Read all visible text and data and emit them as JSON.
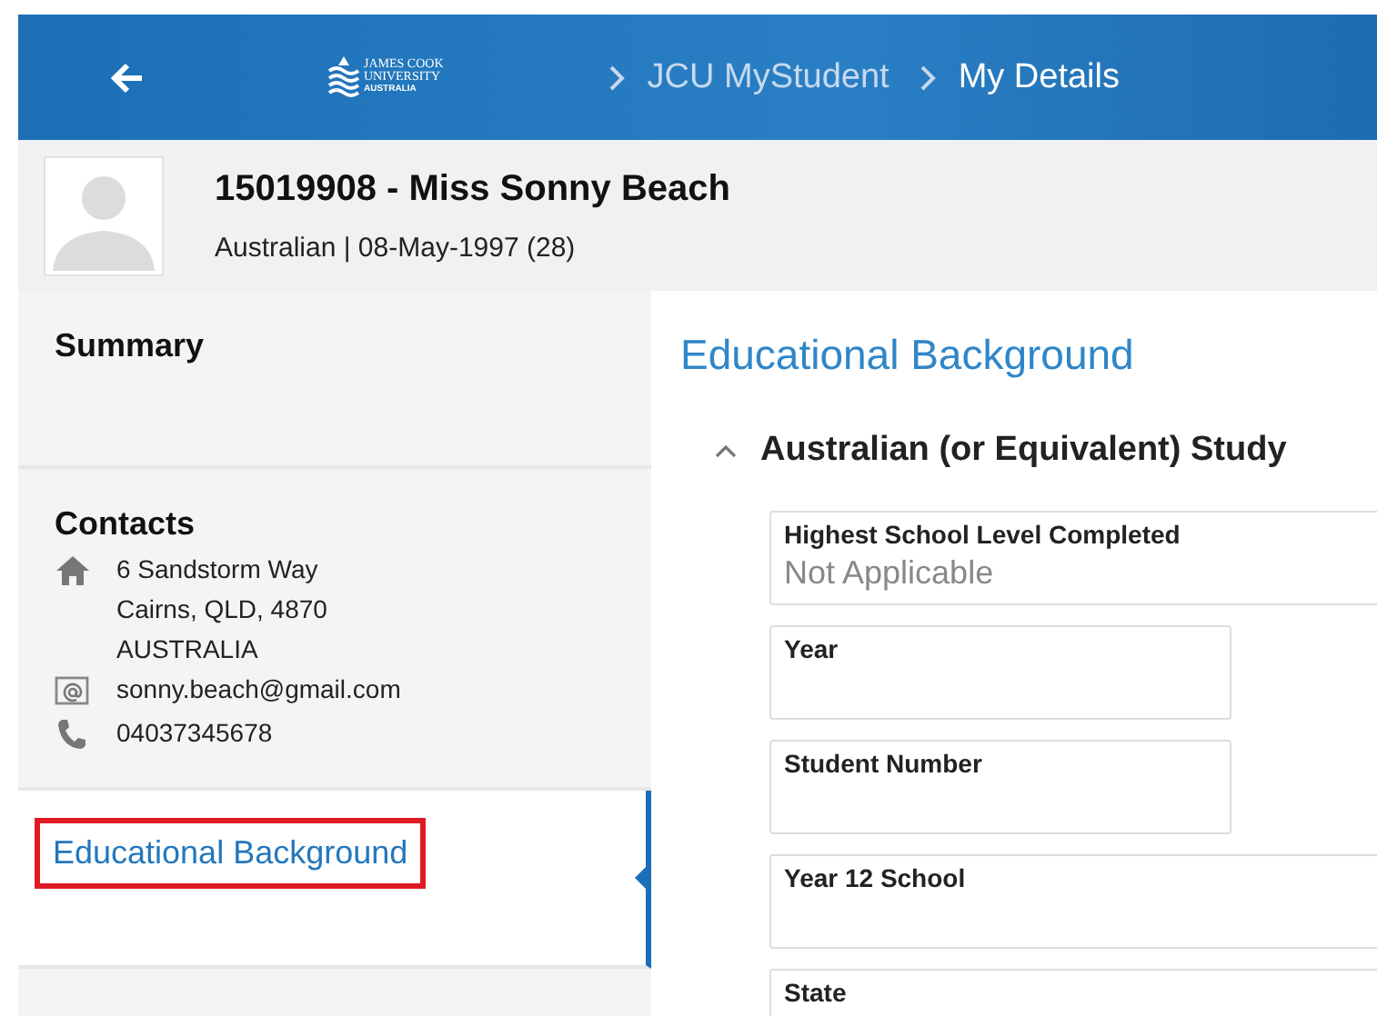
{
  "header": {
    "logo": {
      "lines": [
        "JAMES COOK",
        "UNIVERSITY",
        "AUSTRALIA"
      ]
    },
    "breadcrumbs": [
      {
        "label": "JCU MyStudent",
        "selected": false
      },
      {
        "label": "My Details",
        "selected": true
      }
    ]
  },
  "profile": {
    "title": "15019908 - Miss Sonny Beach",
    "subtitle": "Australian | 08-May-1997 (28)"
  },
  "sidebar": {
    "items": [
      {
        "kind": "section",
        "label": "Summary",
        "selected": false,
        "highlighted": false
      },
      {
        "kind": "contacts",
        "label": "Contacts",
        "selected": false,
        "highlighted": false,
        "contacts": [
          {
            "kind": "address",
            "lines": [
              "6 Sandstorm Way",
              "Cairns, QLD, 4870",
              "AUSTRALIA"
            ]
          },
          {
            "kind": "email",
            "lines": [
              "sonny.beach@gmail.com"
            ]
          },
          {
            "kind": "phone",
            "lines": [
              "04037345678"
            ]
          }
        ]
      },
      {
        "kind": "section",
        "label": "Educational Background",
        "selected": true,
        "highlighted": true
      }
    ]
  },
  "content": {
    "title": "Educational Background",
    "section": {
      "title": "Australian (or Equivalent) Study",
      "expanded": true,
      "fields": [
        {
          "kind": "wide",
          "label": "Highest School Level Completed",
          "value": "Not Applicable"
        },
        {
          "kind": "narrow",
          "label": "Year"
        },
        {
          "kind": "narrow",
          "label": "Student Number"
        },
        {
          "kind": "wide",
          "label": "Year 12 School"
        },
        {
          "kind": "wide",
          "label": "State"
        }
      ]
    }
  }
}
